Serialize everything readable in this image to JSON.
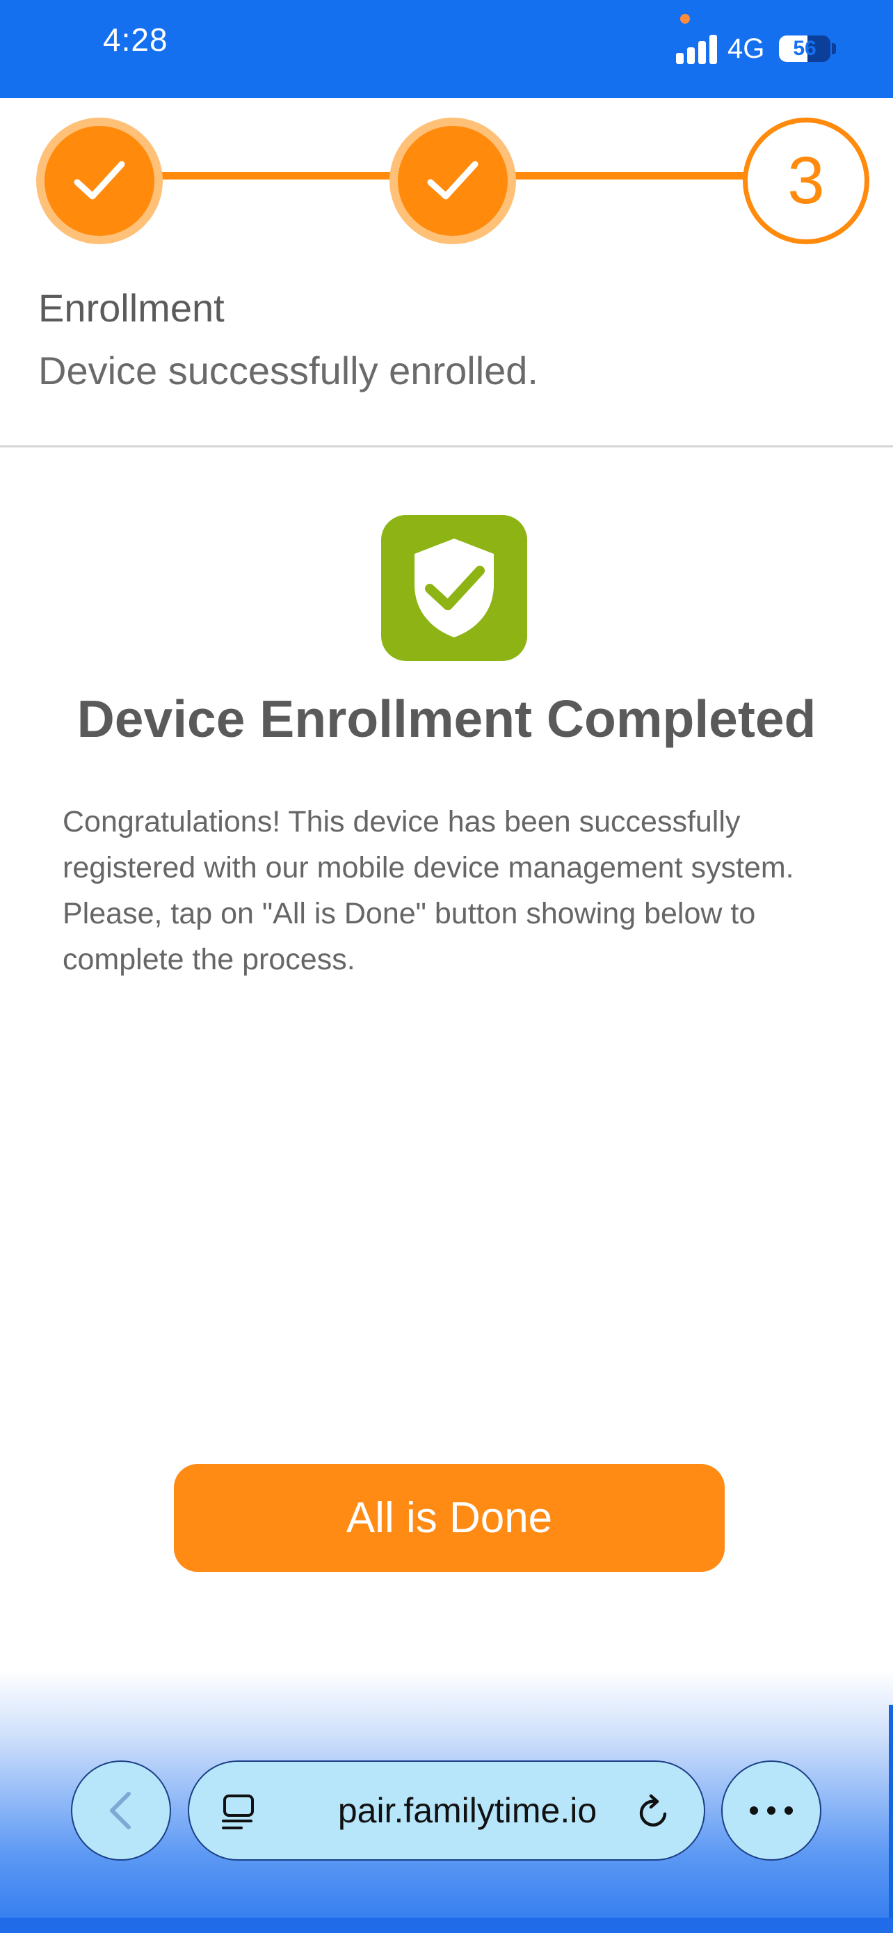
{
  "status_bar": {
    "time": "4:28",
    "network": "4G",
    "battery_level": "56",
    "battery_fraction": 0.56,
    "icons": [
      "privacy-indicator-dot",
      "cellular-signal-icon",
      "battery-icon"
    ],
    "colors": {
      "background": "#1570ef",
      "privacy_dot": "#ff8c3a"
    }
  },
  "stepper": {
    "steps": [
      {
        "state": "completed",
        "icon": "checkmark-icon"
      },
      {
        "state": "completed",
        "icon": "checkmark-icon"
      },
      {
        "state": "current",
        "label": "3"
      }
    ],
    "colors": {
      "active": "#ff8a0c",
      "ring": "#ffc078"
    }
  },
  "step_info": {
    "title": "Enrollment",
    "subtitle": "Device successfully enrolled."
  },
  "content": {
    "icon": "shield-check-icon",
    "icon_color": "#8db414",
    "title": "Device Enrollment Completed",
    "body": "Congratulations! This device has been successfully registered with our mobile device management system. Please, tap on \"All is Done\" button showing below to complete the process."
  },
  "actions": {
    "done_label": "All is Done",
    "done_color": "#ff8a14"
  },
  "browser": {
    "url": "pair.familytime.io",
    "icons": [
      "back-arrow-icon",
      "reader-mode-icon",
      "reload-icon",
      "more-icon"
    ]
  }
}
